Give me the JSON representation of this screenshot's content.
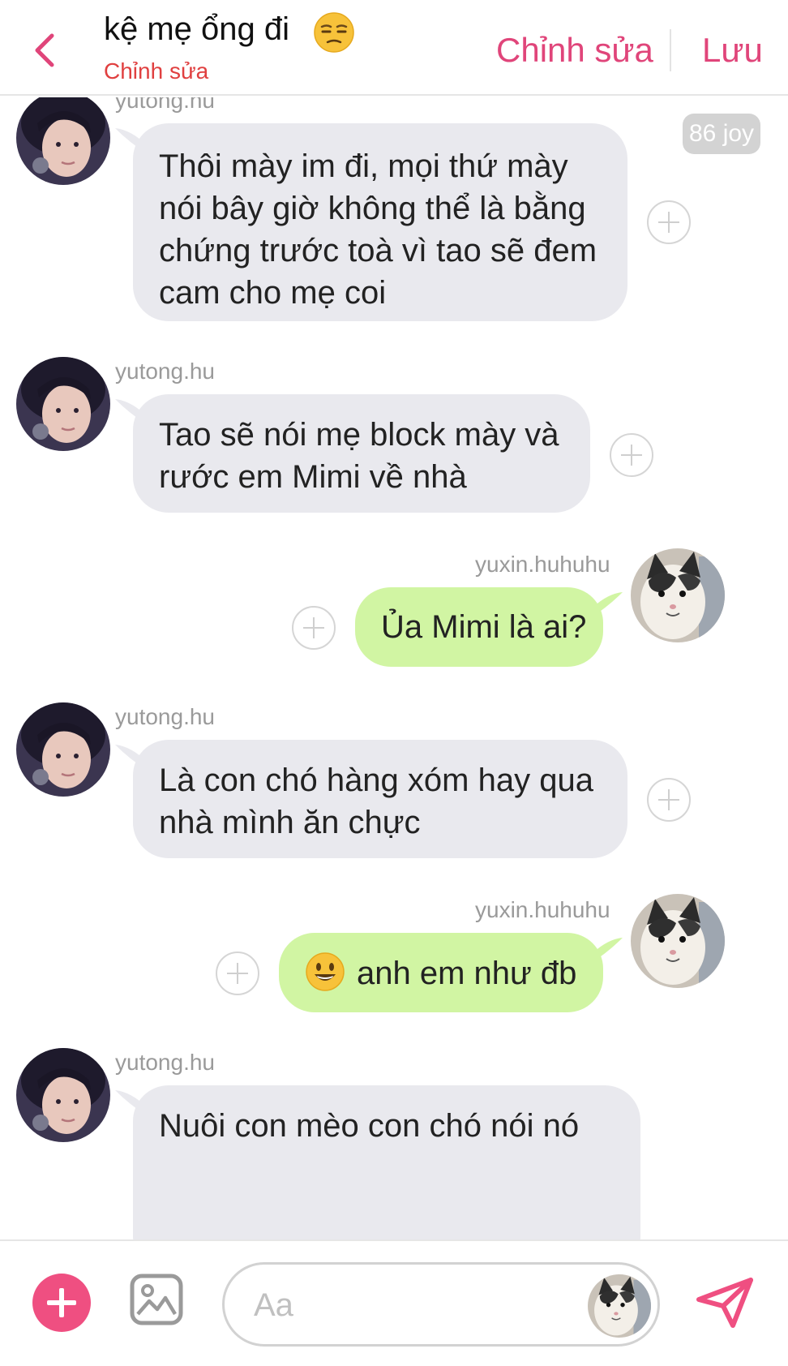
{
  "header": {
    "title": "kệ mẹ ổng đi",
    "subtitle": "Chỉnh sửa",
    "edit_label": "Chỉnh sửa",
    "save_label": "Lưu",
    "title_emoji": "unamused-face-emoji",
    "back_icon": "chevron-left-icon"
  },
  "badge": {
    "text": "86 joy"
  },
  "messages": [
    {
      "sender": "yutong.hu",
      "side": "incoming",
      "lines": [
        "Thôi mày im đi, mọi thứ mày",
        "nói bây giờ không thể là bằng",
        "chứng trước toà vì tao sẽ đem",
        "cam cho mẹ coi"
      ]
    },
    {
      "sender": "yutong.hu",
      "side": "incoming",
      "lines": [
        "Tao sẽ nói mẹ block mày và",
        "rước em Mimi về nhà"
      ]
    },
    {
      "sender": "yuxin.huhuhu",
      "side": "outgoing",
      "lines": [
        "Ủa Mimi là ai?"
      ]
    },
    {
      "sender": "yutong.hu",
      "side": "incoming",
      "lines": [
        "Là con chó hàng xóm hay qua",
        "nhà mình ăn chực"
      ]
    },
    {
      "sender": "yuxin.huhuhu",
      "side": "outgoing",
      "emoji": "smiling-face-emoji",
      "lines": [
        "anh em như đb"
      ]
    },
    {
      "sender": "yutong.hu",
      "side": "incoming",
      "lines": [
        "Nuôi con mèo con chó nói nó"
      ]
    }
  ],
  "composer": {
    "placeholder": "Aa"
  },
  "colors": {
    "accent": "#e0457a",
    "subtitle": "#e04040",
    "incoming_bubble": "#e9e9ee",
    "outgoing_bubble": "#d1f5a3",
    "add_button": "#ef4f81"
  }
}
